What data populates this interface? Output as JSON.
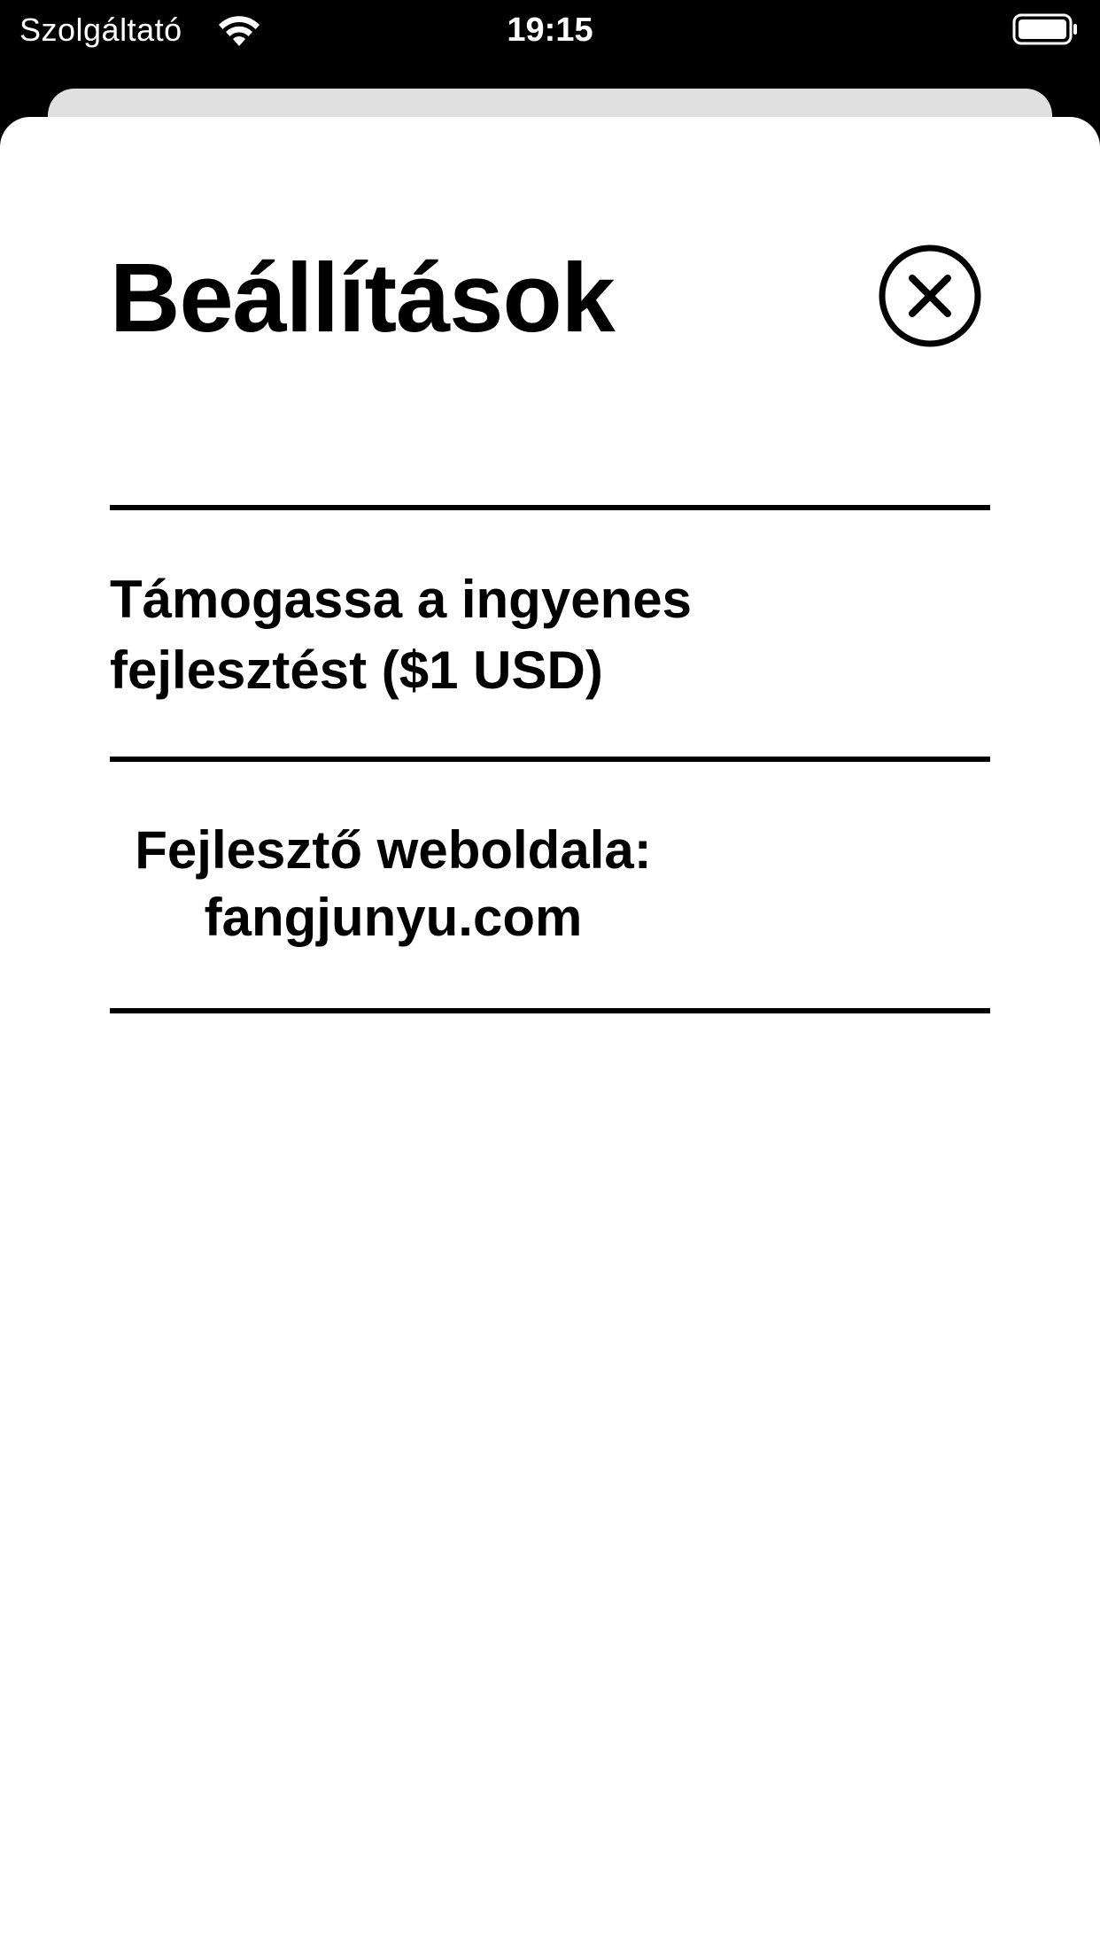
{
  "status_bar": {
    "carrier": "Szolgáltató",
    "time": "19:15",
    "wifi_icon": "wifi-icon",
    "battery_icon": "battery-full-icon"
  },
  "sheet": {
    "title": "Beállítások",
    "close_icon": "close-circle-icon",
    "items": [
      {
        "label": "Támogassa a ingyenes fejlesztést ($1 USD)"
      },
      {
        "label": "Fejlesztő weboldala: fangjunyu.com"
      }
    ]
  },
  "colors": {
    "background": "#ffffff",
    "text": "#000000",
    "status_bar_bg": "#000000",
    "underlying_card": "#e0e0e0"
  }
}
